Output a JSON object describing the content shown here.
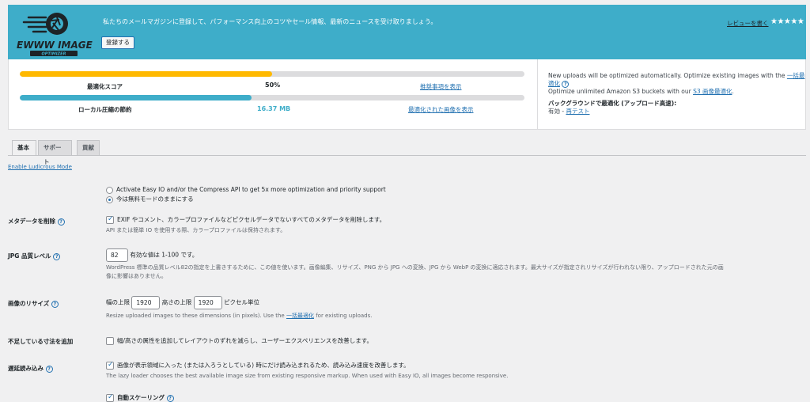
{
  "banner": {
    "logo_text": "EWWW IMAGE",
    "logo_sub": "OPTIMIZER",
    "message": "私たちのメールマガジンに登録して、パフォーマンス向上のコツやセール情報、最新のニュースを受け取りましょう。",
    "subscribe_button": "登録する",
    "review_link": "レビューを書く",
    "stars": "★★★★★"
  },
  "stats": {
    "score_label": "最適化スコア",
    "score_value": "50%",
    "score_fraction": 0.5,
    "score_link": "推奨事項を表示",
    "savings_label": "ローカル圧縮の節約",
    "savings_value": "16.37 MB",
    "savings_fraction": 0.46,
    "savings_link": "最適化された画像を表示",
    "info_line1": "New uploads will be optimized automatically. Optimize existing images with the",
    "bulk_link": "一括最適化",
    "info_line2": "Optimize unlimited Amazon S3 buckets with our",
    "s3_link": "S3 画像最適化",
    "bg_title": "バックグラウンドで最適化 (アップロード高速):",
    "bg_status": "有効 -",
    "retest_link": "再テスト"
  },
  "tabs": [
    "基本",
    "サポート",
    "貢献"
  ],
  "ludicrous_link": "Enable Ludicrous Mode",
  "mode": {
    "option1": "Activate Easy IO and/or the Compress API to get 5x more optimization and priority support",
    "option2": "今は無料モードのままにする"
  },
  "metadata": {
    "label": "メタデータを削除",
    "checkbox": "EXIF やコメント、カラープロファイルなどピクセルデータでないすべてのメタデータを削除します。",
    "desc": "API または簡単 IO を使用する際、カラープロファイルは保持されます。"
  },
  "jpg_quality": {
    "label": "JPG 品質レベル",
    "value": "82",
    "hint": "有効な値は 1-100 です。",
    "desc1": "WordPress 標準の品質レベル82の指定を上書きするために、この値を使います。画像編集、リサイズ、PNG から JPG への変換、JPG から WebP の変換に適応されます。最大サイズが指定されリサイズが行われない限り、アップロードされた元の画",
    "desc2": "像に影響はありません。"
  },
  "resize": {
    "label": "画像のリサイズ",
    "width_label": "幅の上限",
    "width_value": "1920",
    "height_label": "高さの上限",
    "height_value": "1920",
    "unit": "ピクセル単位",
    "desc_before": "Resize uploaded images to these dimensions (in pixels). Use the",
    "desc_link": "一括最適化",
    "desc_after": "for existing uploads."
  },
  "dimensions": {
    "label": "不足している寸法を追加",
    "checkbox": "幅/高さの属性を追加してレイアウトのずれを減らし、ユーザーエクスペリエンスを改善します。"
  },
  "lazy": {
    "label": "遅延読み込み",
    "checkbox": "画像が表示領域に入った (または入ろうとしている) 時にだけ読み込まれるため、読み込み速度を改善します。",
    "desc": "The lazy loader chooses the best available image size from existing responsive markup. When used with Easy IO, all images become responsive.",
    "auto_scale": "自動スケーリング"
  },
  "help_glyph": "?",
  "colors": {
    "banner": "#3eadc9",
    "score_bar": "#ffb900",
    "savings_bar": "#3eadc9",
    "link": "#2271b1"
  }
}
